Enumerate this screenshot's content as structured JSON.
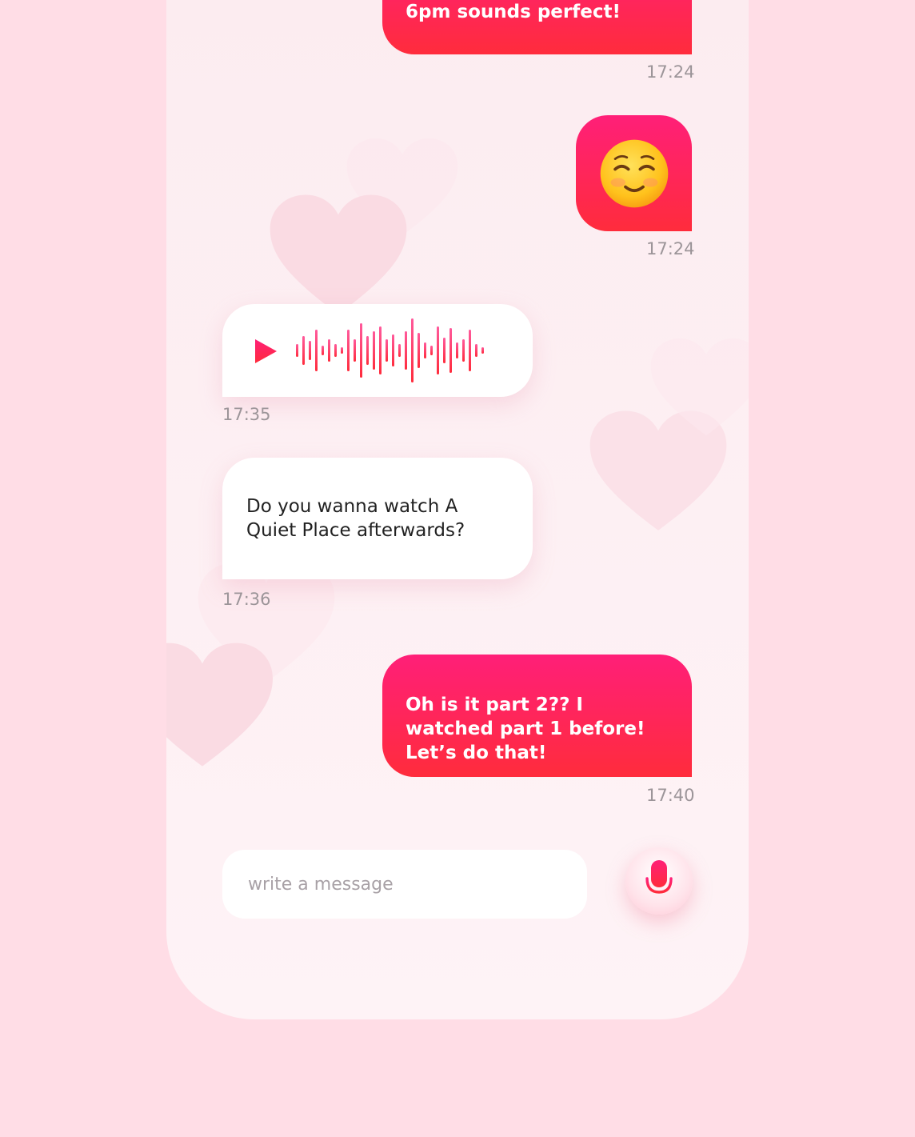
{
  "colors": {
    "accent_start": "#ff1f78",
    "accent_end": "#ff2c3c",
    "page_background": "#ffdde6",
    "timestamp": "#9c9599"
  },
  "messages": [
    {
      "type": "text",
      "direction": "outgoing",
      "text": "6pm sounds perfect!",
      "time": "17:24"
    },
    {
      "type": "emoji",
      "direction": "outgoing",
      "emoji": "☺️",
      "time": "17:24"
    },
    {
      "type": "voice",
      "direction": "incoming",
      "icon": "play-icon",
      "time": "17:35"
    },
    {
      "type": "text",
      "direction": "incoming",
      "text": "Do you wanna watch A Quiet Place afterwards?",
      "time": "17:36"
    },
    {
      "type": "text",
      "direction": "outgoing",
      "text": "Oh is it part 2?? I watched part 1 before! Let’s do that!",
      "time": "17:40"
    }
  ],
  "composer": {
    "placeholder": "write a message",
    "value": "",
    "mic_icon": "microphone-icon"
  }
}
